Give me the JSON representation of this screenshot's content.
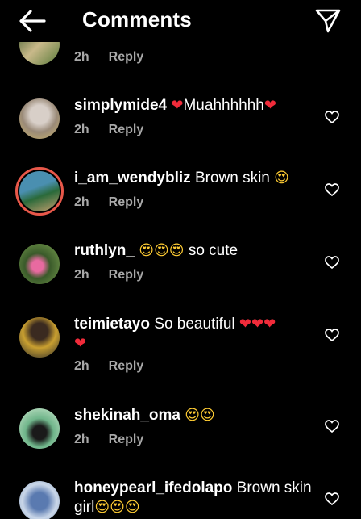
{
  "header": {
    "title": "Comments",
    "back_icon": "arrow-left-icon",
    "send_icon": "paper-plane-icon"
  },
  "comments": [
    {
      "time": "2h",
      "reply": "Reply"
    },
    {
      "user": "simplymide4",
      "text": "Muahhhhhh",
      "time": "2h",
      "reply": "Reply",
      "emoji": "❤"
    },
    {
      "user": "i_am_wendybliz",
      "text": "Brown skin",
      "time": "2h",
      "reply": "Reply",
      "emoji": "😍"
    },
    {
      "user": "ruthlyn_",
      "text": "so cute",
      "time": "2h",
      "reply": "Reply",
      "emoji": "😍"
    },
    {
      "user": "teimietayo",
      "text": "So beautiful",
      "time": "2h",
      "reply": "Reply",
      "emoji": "❤"
    },
    {
      "user": "shekinah_oma",
      "text": "",
      "time": "2h",
      "reply": "Reply",
      "emoji": "😍"
    },
    {
      "user": "honeypearl_ifedolapo",
      "text": "Brown skin",
      "text2": "girl",
      "emoji": "😍"
    }
  ],
  "colors": {
    "background": "#000000",
    "heart": "#f12b3a",
    "meta": "#a8a8a8",
    "story_ring": "#e8584a"
  }
}
